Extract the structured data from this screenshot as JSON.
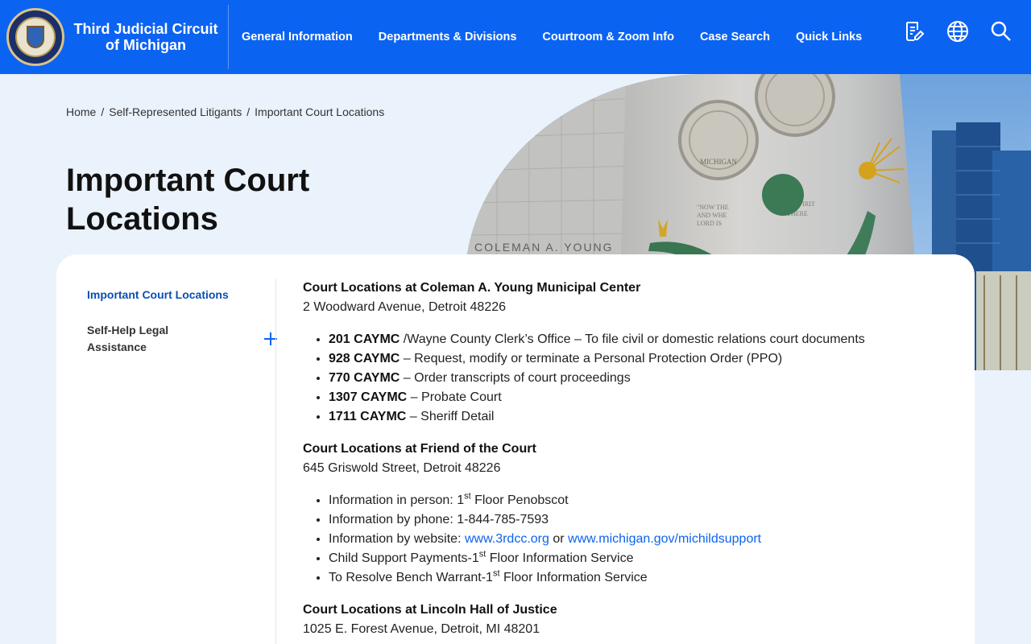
{
  "site": {
    "name_line1": "Third Judicial Circuit",
    "name_line2": "of Michigan"
  },
  "nav": [
    {
      "label": "General Information"
    },
    {
      "label": "Departments & Divisions"
    },
    {
      "label": "Courtroom & Zoom Info"
    },
    {
      "label": "Case Search"
    },
    {
      "label": "Quick Links"
    }
  ],
  "header_icons": [
    "document-edit-icon",
    "globe-icon",
    "search-icon"
  ],
  "breadcrumb": [
    {
      "label": "Home"
    },
    {
      "label": "Self-Represented Litigants"
    },
    {
      "label": "Important Court Locations"
    }
  ],
  "page_title": "Important Court Locations",
  "hero": {
    "inscription": "COLEMAN A. YOUNG",
    "seal_text": "MICHIGAN",
    "quote_left": "\"NOW THE\nAND WHE\nLORD IS",
    "quote_right": "THAT SPIRIT\nTHERE\nTY"
  },
  "sidebar": {
    "active": "Important Court Locations",
    "items": [
      {
        "label": "Self-Help Legal Assistance"
      }
    ]
  },
  "sections": [
    {
      "title": "Court Locations at Coleman A. Young Municipal Center",
      "address": "2 Woodward Avenue, Detroit 48226",
      "items": [
        {
          "bold": "201 CAYMC",
          "text": " /Wayne County Clerk’s Office – To file civil or domestic relations court documents"
        },
        {
          "bold": "928 CAYMC",
          "text": " – Request, modify or terminate a Personal Protection Order (PPO)"
        },
        {
          "bold": "770 CAYMC",
          "text": " – Order transcripts of court proceedings"
        },
        {
          "bold": "1307 CAYMC",
          "text": " – Probate Court"
        },
        {
          "bold": "1711 CAYMC",
          "text": " – Sheriff Detail"
        }
      ]
    },
    {
      "title": "Court Locations at Friend of the Court",
      "address": "645 Griswold Street, Detroit 48226",
      "items": [
        {
          "pre": "Information in person: 1",
          "sup": "st",
          "post": " Floor Penobscot"
        },
        {
          "pre": "Information by phone:  1-844-785-7593"
        },
        {
          "pre": "Information by website: ",
          "link1": "www.3rdcc.org",
          "mid": " or  ",
          "link2": "www.michigan.gov/michildsupport"
        },
        {
          "pre": "Child Support Payments-1",
          "sup": "st",
          "post": " Floor Information Service"
        },
        {
          "pre": "To Resolve Bench Warrant-1",
          "sup": "st",
          "post": " Floor Information Service"
        }
      ]
    },
    {
      "title": "Court Locations at Lincoln Hall of Justice",
      "address": "1025 E. Forest Avenue, Detroit, MI  48201"
    }
  ]
}
